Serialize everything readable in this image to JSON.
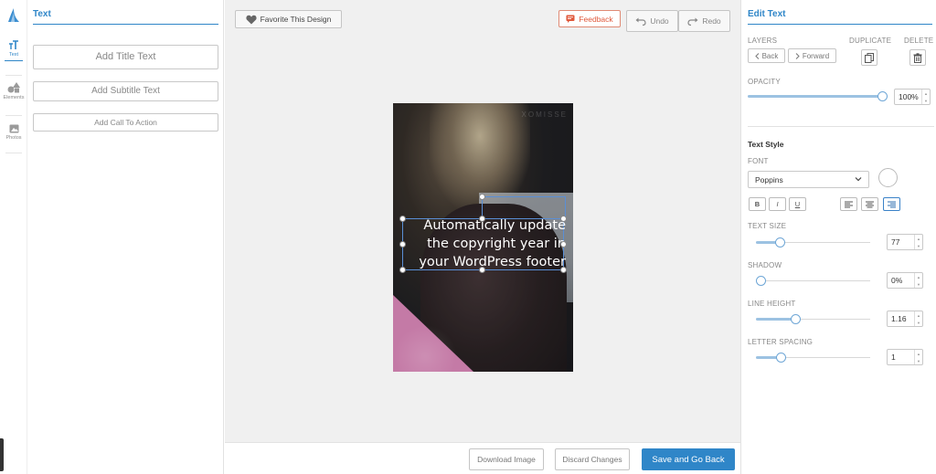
{
  "left_rail": {
    "items": [
      {
        "label": "Text",
        "icon": "text-size-icon"
      },
      {
        "label": "Elements",
        "icon": "shapes-icon"
      },
      {
        "label": "Photos",
        "icon": "image-icon"
      }
    ]
  },
  "left_panel": {
    "title": "Text",
    "add_title": "Add Title Text",
    "add_subtitle": "Add Subtitle Text",
    "add_cta": "Add Call To Action"
  },
  "toolbar": {
    "favorite": "Favorite This Design",
    "feedback": "Feedback",
    "undo": "Undo",
    "redo": "Redo"
  },
  "design": {
    "brand": "XOMISSE",
    "text": "Automatically update\nthe copyright year in\nyour WordPress footer"
  },
  "bottom": {
    "download": "Download Image",
    "discard": "Discard Changes",
    "save": "Save and Go Back"
  },
  "edit_text": {
    "title": "Edit Text",
    "layers_label": "LAYERS",
    "back": "Back",
    "forward": "Forward",
    "duplicate_label": "DUPLICATE",
    "delete_label": "DELETE",
    "opacity_label": "OPACITY",
    "opacity_value": "100%",
    "opacity_level": 1.0,
    "text_style_title": "Text Style",
    "font_label": "FONT",
    "font_value": "Poppins",
    "bold": "B",
    "italic": "I",
    "underline": "U",
    "text_size_label": "TEXT SIZE",
    "text_size_value": "77",
    "text_size_level": 0.18,
    "shadow_label": "SHADOW",
    "shadow_value": "0%",
    "shadow_level": 0.0,
    "line_height_label": "LINE HEIGHT",
    "line_height_value": "1.16",
    "line_height_level": 0.33,
    "letter_spacing_label": "LETTER SPACING",
    "letter_spacing_value": "1",
    "letter_spacing_level": 0.19
  },
  "colors": {
    "accent": "#2f86c8",
    "feedback": "#e0583b"
  }
}
